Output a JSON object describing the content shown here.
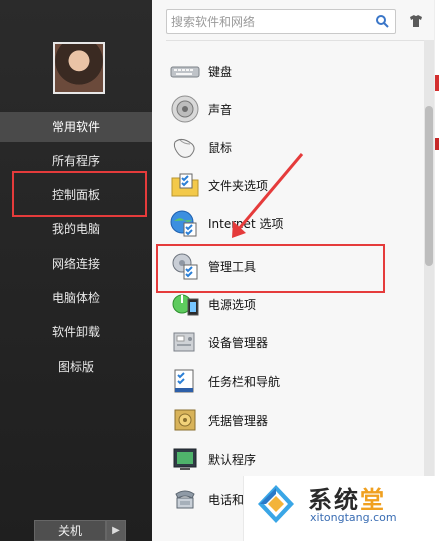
{
  "left_panel": {
    "nav": [
      {
        "label": "常用软件"
      },
      {
        "label": "所有程序"
      },
      {
        "label": "控制面板"
      },
      {
        "label": "我的电脑"
      },
      {
        "label": "网络连接"
      },
      {
        "label": "电脑体检"
      },
      {
        "label": "软件卸载"
      },
      {
        "label": "图标版"
      }
    ],
    "shutdown_label": "关机"
  },
  "search": {
    "placeholder": "搜索软件和网络"
  },
  "items": [
    {
      "label": "键盘",
      "icon": "keyboard-icon"
    },
    {
      "label": "声音",
      "icon": "speaker-icon"
    },
    {
      "label": "鼠标",
      "icon": "mouse-icon"
    },
    {
      "label": "文件夹选项",
      "icon": "folder-options-icon"
    },
    {
      "label": "Internet 选项",
      "icon": "internet-options-icon"
    },
    {
      "label": "管理工具",
      "icon": "admin-tools-icon"
    },
    {
      "label": "电源选项",
      "icon": "power-options-icon"
    },
    {
      "label": "设备管理器",
      "icon": "device-manager-icon"
    },
    {
      "label": "任务栏和导航",
      "icon": "taskbar-icon"
    },
    {
      "label": "凭据管理器",
      "icon": "credential-manager-icon"
    },
    {
      "label": "默认程序",
      "icon": "default-programs-icon"
    },
    {
      "label": "电话和调",
      "icon": "phone-modem-icon"
    }
  ],
  "watermark": {
    "brand_a": "系统",
    "brand_b": "堂",
    "domain": "xitongtang.com"
  },
  "colors": {
    "highlight_red": "#e53b3b",
    "left_bg": "#2b2b2b",
    "active_nav": "#4a4a4a"
  }
}
